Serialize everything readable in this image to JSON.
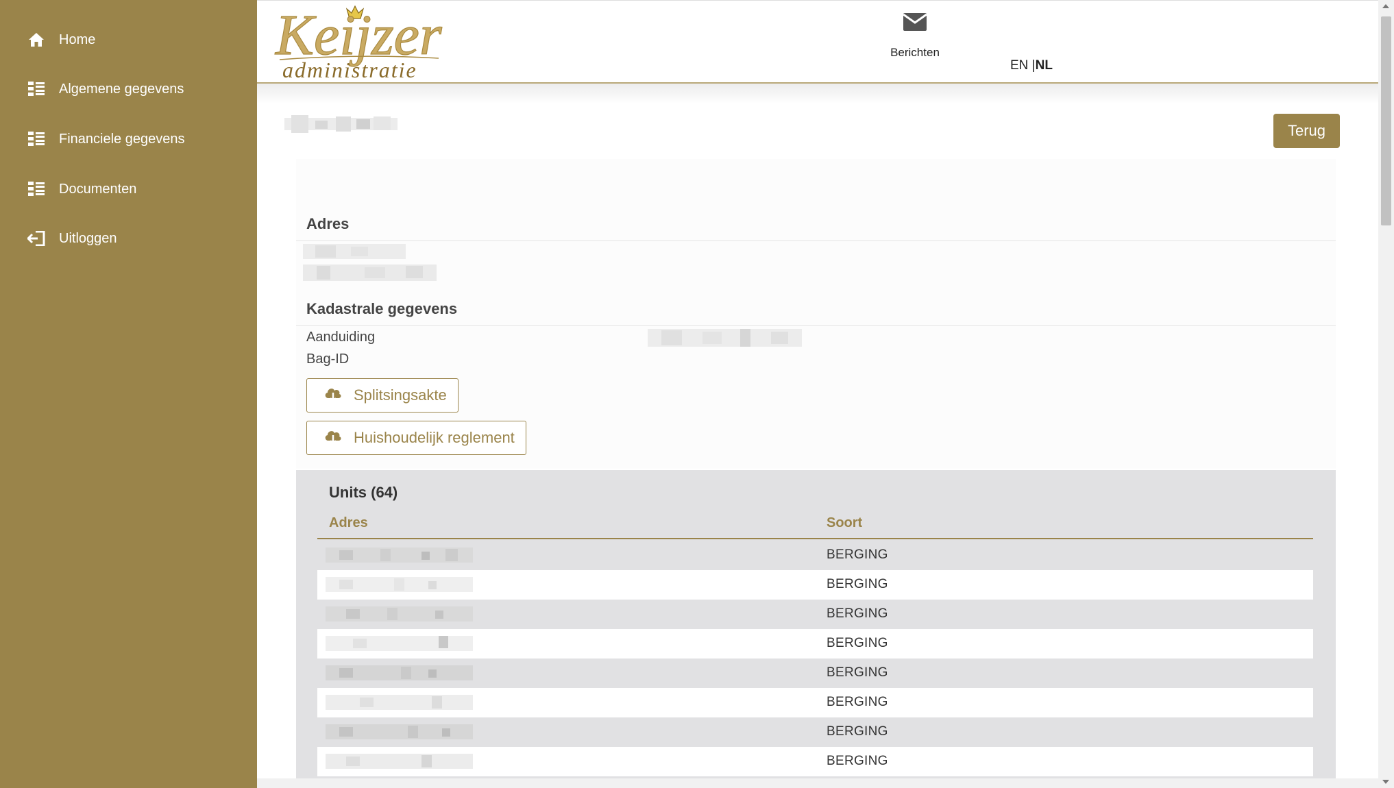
{
  "sidebar": {
    "items": [
      {
        "label": "Home",
        "icon": "home-icon"
      },
      {
        "label": "Algemene gegevens",
        "icon": "list-icon"
      },
      {
        "label": "Financiele gegevens",
        "icon": "list-icon"
      },
      {
        "label": "Documenten",
        "icon": "list-icon"
      },
      {
        "label": "Uitloggen",
        "icon": "logout-icon"
      }
    ]
  },
  "header": {
    "logo_text": "Keijzer",
    "logo_subtext": "administratie",
    "messages_label": "Berichten",
    "lang_en": "EN",
    "lang_sep": " |",
    "lang_nl": "NL"
  },
  "page": {
    "back_button": "Terug"
  },
  "sections": {
    "adres_title": "Adres",
    "kadastraal_title": "Kadastrale gegevens",
    "aanduiding_label": "Aanduiding",
    "bagid_label": "Bag-ID"
  },
  "downloads": [
    {
      "label": "Splitsingsakte",
      "icon": "cloud-download-icon"
    },
    {
      "label": "Huishoudelijk reglement",
      "icon": "cloud-download-icon"
    }
  ],
  "units": {
    "title": "Units (64)",
    "columns": [
      "Adres",
      "Soort"
    ],
    "rows": [
      {
        "soort": "BERGING"
      },
      {
        "soort": "BERGING"
      },
      {
        "soort": "BERGING"
      },
      {
        "soort": "BERGING"
      },
      {
        "soort": "BERGING"
      },
      {
        "soort": "BERGING"
      },
      {
        "soort": "BERGING"
      },
      {
        "soort": "BERGING"
      }
    ]
  },
  "colors": {
    "brand": "#9a844a",
    "stripe": "#e1e1e3"
  }
}
